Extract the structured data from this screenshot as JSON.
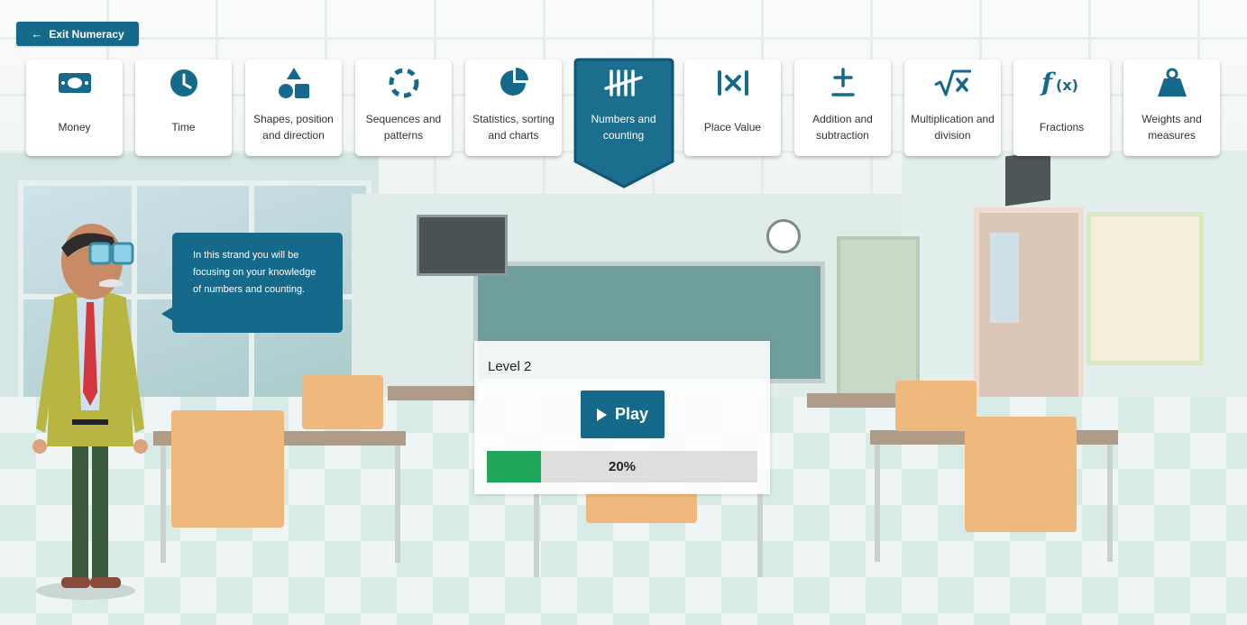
{
  "exit_button": {
    "label": "Exit Numeracy",
    "icon": "arrow-left-icon"
  },
  "strands": [
    {
      "label": "Money",
      "icon": "money-icon",
      "active": false
    },
    {
      "label": "Time",
      "icon": "clock-icon",
      "active": false
    },
    {
      "label": "Shapes, position and direction",
      "icon": "shapes-icon",
      "active": false
    },
    {
      "label": "Sequences and patterns",
      "icon": "dashed-circle-icon",
      "active": false
    },
    {
      "label": "Statistics, sorting and charts",
      "icon": "pie-chart-icon",
      "active": false
    },
    {
      "label": "Numbers and counting",
      "icon": "tally-marks-icon",
      "active": true
    },
    {
      "label": "Place Value",
      "icon": "place-value-icon",
      "active": false
    },
    {
      "label": "Addition and subtraction",
      "icon": "plus-minus-icon",
      "active": false
    },
    {
      "label": "Multiplication and division",
      "icon": "square-root-x-icon",
      "active": false
    },
    {
      "label": "Fractions",
      "icon": "function-icon",
      "active": false
    },
    {
      "label": "Weights and measures",
      "icon": "weight-icon",
      "active": false
    }
  ],
  "speech_bubble": {
    "text": "In this strand you will be focusing on your knowledge of numbers and counting."
  },
  "level_panel": {
    "title": "Level 2",
    "play_label": "Play",
    "progress_percent": 20,
    "progress_label": "20%"
  },
  "colors": {
    "primary": "#156a8c",
    "active_card": "#1c6e8f",
    "progress_fill": "#1fa65a",
    "icon": "#156a8c"
  }
}
